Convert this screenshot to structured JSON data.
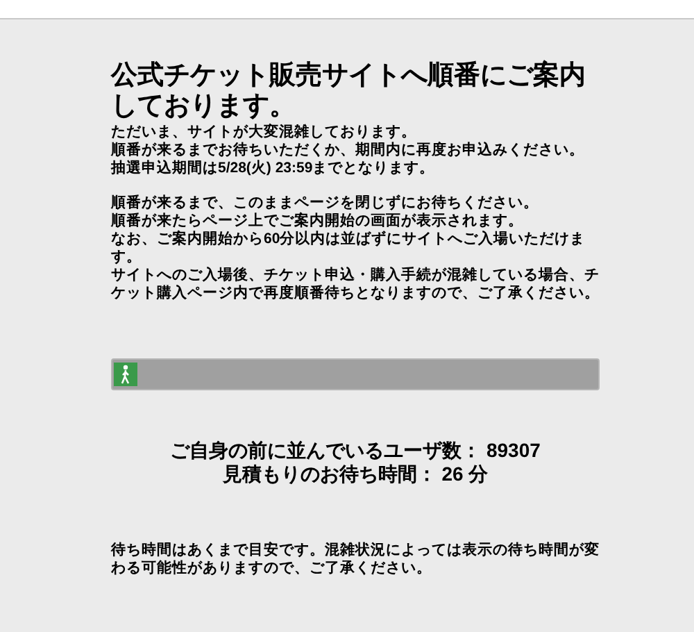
{
  "title": "公式チケット販売サイトへ順番にご案内しております。",
  "notice_paragraphs": [
    [
      "ただいま、サイトが大変混雑しております。",
      "順番が来るまでお待ちいただくか、期間内に再度お申込みください。",
      "抽選申込期間は5/28(火) 23:59までとなります。"
    ],
    [
      "順番が来るまで、このままページを閉じずにお待ちください。",
      "順番が来たらページ上でご案内開始の画面が表示されます。",
      "なお、ご案内開始から60分以内は並ばずにサイトへご入場いただけます。",
      "サイトへのご入場後、チケット申込・購入手続が混雑している場合、チケット購入ページ内で再度順番待ちとなりますので、ご了承ください。"
    ]
  ],
  "queue_progress": {
    "level": 0
  },
  "queue_status": [
    "ご自身の前に並んでいるユーザ数： 89307",
    "見積もりのお待ち時間： 26 分"
  ],
  "footnote": "待ち時間はあくまで目安です。混雑状況によっては表示の待ち時間が変わる可能性がありますので、ご了承ください。"
}
